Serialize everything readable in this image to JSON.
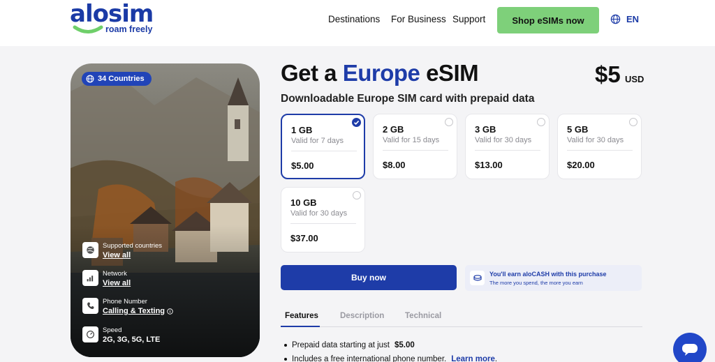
{
  "header": {
    "logo_word": "alosim",
    "logo_tagline": "roam freely",
    "nav": [
      "Destinations",
      "For Business",
      "Support"
    ],
    "cta": "Shop eSIMs now",
    "language": "EN"
  },
  "hero": {
    "countries_badge": "34 Countries",
    "rows": [
      {
        "label": "Supported countries",
        "value": "View all"
      },
      {
        "label": "Network",
        "value": "View all"
      },
      {
        "label": "Phone Number",
        "value": "Calling & Texting"
      },
      {
        "label": "Speed",
        "value": "2G, 3G, 5G, LTE"
      }
    ]
  },
  "product": {
    "title_prefix": "Get a",
    "title_highlight": "Europe",
    "title_suffix": "eSIM",
    "price": "$5",
    "currency": "USD",
    "subtitle": "Downloadable Europe SIM card with prepaid data",
    "selected_plan": 0,
    "plans": [
      {
        "data": "1 GB",
        "validity": "Valid for 7 days",
        "price": "$5.00"
      },
      {
        "data": "2 GB",
        "validity": "Valid for 15 days",
        "price": "$8.00"
      },
      {
        "data": "3 GB",
        "validity": "Valid for 30 days",
        "price": "$13.00"
      },
      {
        "data": "5 GB",
        "validity": "Valid for 30 days",
        "price": "$20.00"
      },
      {
        "data": "10 GB",
        "validity": "Valid for 30 days",
        "price": "$37.00"
      }
    ],
    "buy_label": "Buy now",
    "earn_title": "You'll earn aloCASH with this purchase",
    "earn_subtitle": "The more you spend, the more you earn"
  },
  "tabs": [
    "Features",
    "Description",
    "Technical"
  ],
  "features": {
    "item1_text": "Prepaid data starting at just",
    "item1_value": "$5.00",
    "item2_text": "Includes a free international phone number.",
    "item2_link": "Learn more",
    "item2_suffix": "."
  },
  "colors": {
    "brand_blue": "#1e3ca8",
    "cta_green": "#7ed07a",
    "page_bg": "#f4f4f6"
  }
}
